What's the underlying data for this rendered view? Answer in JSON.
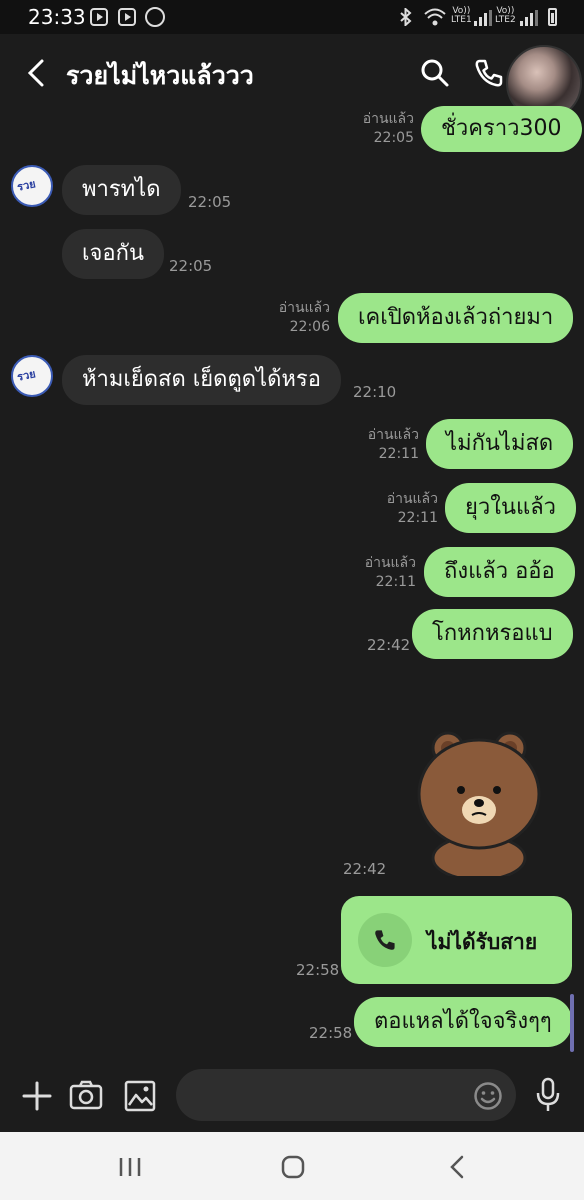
{
  "status_bar": {
    "time": "23:33",
    "lte1": "LTE1",
    "lte2": "LTE2",
    "volte1": "Vo))",
    "volte2": "Vo))"
  },
  "header": {
    "title": "รวยไม่ไหวแล้ววว"
  },
  "messages": {
    "m0": {
      "text": "ชั่วคราว300",
      "read": "อ่านแล้ว",
      "time": "22:05"
    },
    "m1": {
      "text": "พารทได",
      "time": "22:05"
    },
    "m2": {
      "text": "เจอกัน",
      "time": "22:05"
    },
    "m3": {
      "text": "เคเปิดห้องเล้วถ่ายมา",
      "read": "อ่านแล้ว",
      "time": "22:06"
    },
    "m4": {
      "text": "ห้ามเย็ดสด เย็ดตูดได้หรอ",
      "time": "22:10"
    },
    "m5": {
      "text": "ไม่กันไม่สด",
      "read": "อ่านแล้ว",
      "time": "22:11"
    },
    "m6": {
      "text": "ยุวในแล้ว",
      "read": "อ่านแล้ว",
      "time": "22:11"
    },
    "m7": {
      "text": "ถึงแล้ว ออ้อ",
      "read": "อ่านแล้ว",
      "time": "22:11"
    },
    "m8": {
      "text": "โกหกหรอแบ",
      "time": "22:42"
    },
    "sticker": {
      "time": "22:42"
    },
    "call": {
      "text": "ไม่ได้รับสาย",
      "time": "22:58"
    },
    "m9": {
      "text": "ตอแหลได้ใจจริงๆๆ",
      "time": "22:58"
    }
  },
  "avatar_text": "รวย",
  "colors": {
    "background": "#1c1c1c",
    "outgoing": "#9ce68a",
    "incoming": "#2d2d2d"
  }
}
